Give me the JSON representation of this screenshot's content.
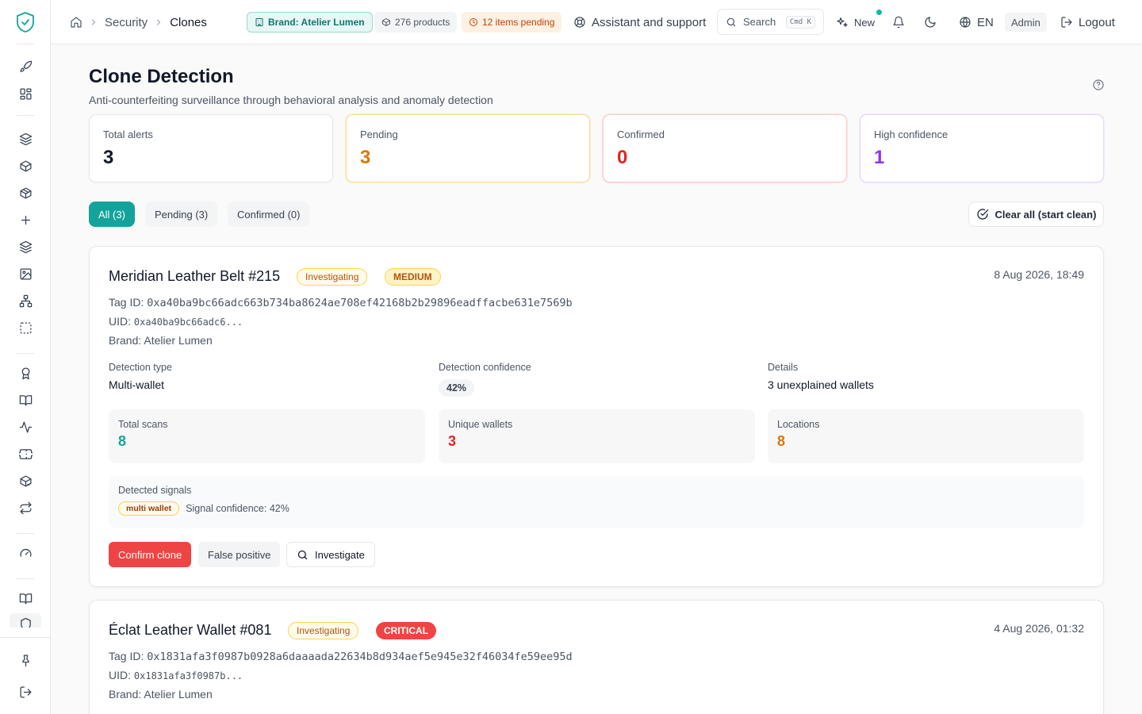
{
  "header": {
    "breadcrumb": [
      "Security",
      "Clones"
    ],
    "brand_pill": "Brand: Atelier Lumen",
    "products_pill": "276 products",
    "pending_pill": "12 items pending",
    "assistant": "Assistant and support",
    "search_placeholder": "Search",
    "search_shortcut": "Cmd K",
    "new_label": "New",
    "language": "EN",
    "role": "Admin",
    "logout": "Logout"
  },
  "page": {
    "title": "Clone Detection",
    "subtitle": "Anti-counterfeiting surveillance through behavioral analysis and anomaly detection"
  },
  "stats": [
    {
      "label": "Total alerts",
      "value": "3"
    },
    {
      "label": "Pending",
      "value": "3"
    },
    {
      "label": "Confirmed",
      "value": "0"
    },
    {
      "label": "High confidence",
      "value": "1"
    }
  ],
  "tabs": [
    {
      "label": "All (3)",
      "active": true
    },
    {
      "label": "Pending (3)",
      "active": false
    },
    {
      "label": "Confirmed (0)",
      "active": false
    }
  ],
  "clear_all": "Clear all (start clean)",
  "labels": {
    "tag_id": "Tag ID:",
    "uid": "UID:",
    "brand": "Brand:",
    "detection_type": "Detection type",
    "detection_confidence": "Detection confidence",
    "details": "Details",
    "total_scans": "Total scans",
    "unique_wallets": "Unique wallets",
    "locations": "Locations",
    "detected_signals": "Detected signals"
  },
  "alerts": [
    {
      "title": "Meridian Leather Belt #215",
      "status": "Investigating",
      "severity": "MEDIUM",
      "date": "8 Aug 2026, 18:49",
      "tag_id": "0xa40ba9bc66adc663b734ba8624ae708ef42168b2b29896eadffacbe631e7569b",
      "uid": "0xa40ba9bc66adc6...",
      "brand": "Atelier Lumen",
      "detection_type": "Multi-wallet",
      "confidence": "42%",
      "details": "3 unexplained wallets",
      "total_scans": "8",
      "unique_wallets": "3",
      "locations": "8",
      "signal_tag": "multi wallet",
      "signal_confidence": "Signal confidence: 42%",
      "actions": {
        "confirm": "Confirm clone",
        "false_positive": "False positive",
        "investigate": "Investigate"
      }
    },
    {
      "title": "Éclat Leather Wallet #081",
      "status": "Investigating",
      "severity": "CRITICAL",
      "date": "4 Aug 2026, 01:32",
      "tag_id": "0x1831afa3f0987b0928a6daaaada22634b8d934aef5e945e32f46034fe59ee95d",
      "uid": "0x1831afa3f0987b...",
      "brand": "Atelier Lumen"
    }
  ],
  "colors": {
    "accent": "#14a39a",
    "pending": "#d97706",
    "confirmed": "#dc2626",
    "high_confidence": "#9333ea",
    "danger": "#ef4444"
  },
  "sidebar_icons": [
    "shield-logo-icon",
    "rocket-icon",
    "dashboard-grid-icon",
    "layers-icon",
    "box-icon",
    "package-icon",
    "plus-icon",
    "stack-icon",
    "image-icon",
    "hierarchy-icon",
    "selection-icon",
    "award-icon",
    "book-icon",
    "activity-icon",
    "ticket-icon",
    "package-check-icon",
    "repeat-icon",
    "gauge-icon",
    "book-open-icon",
    "security-icon",
    "pin-icon",
    "logout-icon"
  ]
}
